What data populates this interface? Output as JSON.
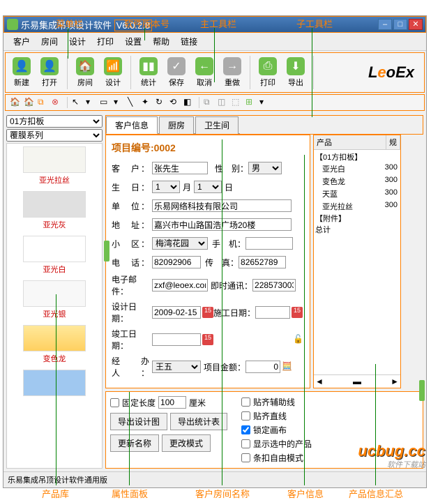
{
  "annotations": {
    "menubar": "菜单栏",
    "version": "软件版本号",
    "maintb": "主工具栏",
    "subtb": "子工具栏",
    "prodlib": "产品库",
    "attrpanel": "属性面板",
    "roomname": "客户房间名称",
    "custinfo": "客户信息",
    "prodsum": "产品信息汇总"
  },
  "title": "乐易集成吊顶设计软件",
  "version": "V6.0.2.8",
  "menu": [
    "客户",
    "房间",
    "设计",
    "打印",
    "设置",
    "帮助",
    "链接"
  ],
  "toolbar": [
    {
      "label": "新建",
      "icon": "👤"
    },
    {
      "label": "打开",
      "icon": "👤"
    },
    {
      "label": "房间",
      "icon": "🏠"
    },
    {
      "label": "设计",
      "icon": "📡"
    },
    {
      "label": "统计",
      "icon": "▮"
    },
    {
      "label": "保存",
      "icon": "✓"
    },
    {
      "label": "取消",
      "icon": "←"
    },
    {
      "label": "重做",
      "icon": "→"
    },
    {
      "label": "打印",
      "icon": "🖨"
    },
    {
      "label": "导出",
      "icon": "⬇"
    }
  ],
  "logo": "LeoEx",
  "left_selects": [
    "01方扣板",
    "覆膜系列"
  ],
  "swatches": [
    {
      "label": "亚光拉丝",
      "bg": "#f5f5f0"
    },
    {
      "label": "亚光灰",
      "bg": "#e0e0e0"
    },
    {
      "label": "亚光白",
      "bg": "#ffffff"
    },
    {
      "label": "亚光银",
      "bg": "#f8f8f8"
    },
    {
      "label": "变色龙",
      "bg": "linear-gradient(#ffe89a,#ffd060)"
    },
    {
      "label": "",
      "bg": "#a0c8f0"
    }
  ],
  "tabs": [
    "客户信息",
    "厨房",
    "卫生间"
  ],
  "form": {
    "title": "项目编号:0002",
    "customer_lbl": "客　户",
    "customer": "张先生",
    "gender_lbl": "性　别：",
    "gender": "男",
    "birth_lbl": "生　日",
    "birth_month": "1",
    "birth_month_unit": "月",
    "birth_day": "1",
    "birth_day_unit": "日",
    "company_lbl": "单　位",
    "company": "乐易网络科技有限公司",
    "address_lbl": "地　址",
    "address": "嘉兴市中山路国浩广场20楼",
    "district_lbl": "小　区",
    "district": "梅湾花园",
    "mobile_lbl": "手　机：",
    "mobile": "",
    "phone_lbl": "电　话",
    "phone": "82092906",
    "fax_lbl": "传　真：",
    "fax": "82652789",
    "email_lbl": "电子邮件：",
    "email": "zxf@leoex.com",
    "im_lbl": "即时通讯：",
    "im": "228573003",
    "design_date_lbl": "设计日期：",
    "design_date": "2009-02-15",
    "work_date_lbl": "施工日期：",
    "work_date": "",
    "finish_date_lbl": "竣工日期：",
    "finish_date": "",
    "handler_lbl": "经 办 人",
    "handler": "王五",
    "amount_lbl": "项目金额：",
    "amount": "0"
  },
  "right": {
    "col1": "产品",
    "col2": "规",
    "group1": "【01方扣板】",
    "items": [
      {
        "name": "亚光白",
        "val": "300"
      },
      {
        "name": "变色龙",
        "val": "300"
      },
      {
        "name": "天蓝",
        "val": "300"
      },
      {
        "name": "亚光拉丝",
        "val": "300"
      }
    ],
    "group2": "【附件】",
    "total_lbl": "总计"
  },
  "bottom": {
    "fixed_len_lbl": "固定长度",
    "fixed_len": "100",
    "unit": "厘米",
    "export_design": "导出设计图",
    "export_stats": "导出统计表",
    "update_name": "更新名称",
    "change_mode": "更改模式",
    "snap_guide": "贴齐辅助线",
    "snap_line": "贴齐直线",
    "lock_canvas": "锁定画布",
    "show_selected": "显示选中的产品",
    "strip_free": "条扣自由模式"
  },
  "statusbar": "乐易集成吊顶设计软件通用版",
  "watermark_site": "软件下载站",
  "watermark_logo": "ucbug.cc"
}
